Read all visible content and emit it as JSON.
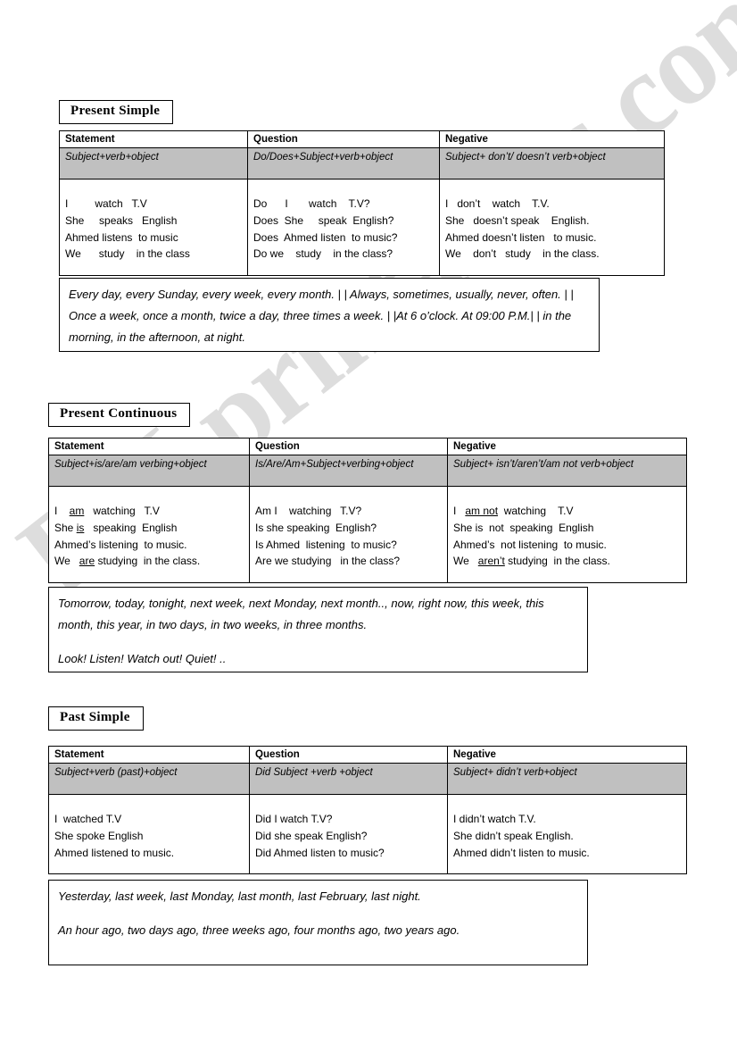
{
  "watermark": {
    "text": "ESLprintables.com"
  },
  "sections": [
    {
      "id": "present-simple",
      "title": "Present Simple",
      "headers": {
        "statement": "Statement",
        "question": "Question",
        "negative": "Negative"
      },
      "formulas": {
        "statement": "Subject+verb+object",
        "question": "Do/Does+Subject+verb+object",
        "negative": "Subject+ don’t/ doesn’t verb+object"
      },
      "examples": {
        "statement": [
          "I         watch   T.V",
          "She     speaks   English",
          "Ahmed listens  to music",
          "We      study    in the class"
        ],
        "question": [
          "Do      I       watch    T.V?",
          "Does  She     speak  English?",
          "Does  Ahmed listen  to music?",
          "Do we    study    in the class?"
        ],
        "negative": [
          "I   don’t    watch    T.V.",
          "She   doesn’t speak    English.",
          "Ahmed doesn’t listen   to music.",
          "We    don’t   study    in the class."
        ]
      },
      "time_expressions": [
        "Every day, every Sunday, every week, every month. | | Always, sometimes, usually, never, often. | | Once a week, once a month, twice a day, three times a week. | |At 6 o’clock. At 09:00 P.M.| | in the morning, in the afternoon, at night."
      ]
    },
    {
      "id": "present-continuous",
      "title": "Present Continuous",
      "headers": {
        "statement": "Statement",
        "question": "Question",
        "negative": "Negative"
      },
      "formulas": {
        "statement": "Subject+is/are/am verbing+object",
        "question": "Is/Are/Am+Subject+verbing+object",
        "negative": "Subject+ isn’t/aren’t/am not verb+object"
      },
      "examples": {
        "statement": [
          "I    [u]am[/u]   watching   T.V",
          "She [u]is[/u]   speaking  English",
          "Ahmed’s listening  to music.",
          "We   [u]are[/u] studying  in the class."
        ],
        "question": [
          "Am I    watching   T.V?",
          "Is she speaking  English?",
          "Is Ahmed  listening  to music?",
          "Are we studying   in the class?"
        ],
        "negative": [
          "I   [u]am not[/u]  watching    T.V",
          "She is  not  speaking  English",
          "Ahmed’s  not listening  to music.",
          "We   [u]aren’t[/u] studying  in the class."
        ]
      },
      "time_expressions": [
        "Tomorrow, today, tonight, next week, next Monday, next month.., now, right now, this week, this month, this year, in two days, in two weeks, in three months.",
        "Look! Listen! Watch out! Quiet! .."
      ]
    },
    {
      "id": "past-simple",
      "title": "Past Simple",
      "headers": {
        "statement": "Statement",
        "question": "Question",
        "negative": "Negative"
      },
      "formulas": {
        "statement": "Subject+verb (past)+object",
        "question": "Did Subject +verb +object",
        "negative": "Subject+ didn’t verb+object"
      },
      "examples": {
        "statement": [
          "I  watched T.V",
          "She spoke English",
          "Ahmed listened to music."
        ],
        "question": [
          "Did I watch T.V?",
          "Did she speak English?",
          "Did Ahmed listen to music?"
        ],
        "negative": [
          "I didn’t watch T.V.",
          "She didn’t speak English.",
          "Ahmed didn’t listen to music."
        ]
      },
      "time_expressions": [
        "Yesterday, last week, last Monday, last month, last February, last night.",
        "An hour ago, two days ago, three weeks ago, four months ago, two years ago."
      ]
    }
  ]
}
